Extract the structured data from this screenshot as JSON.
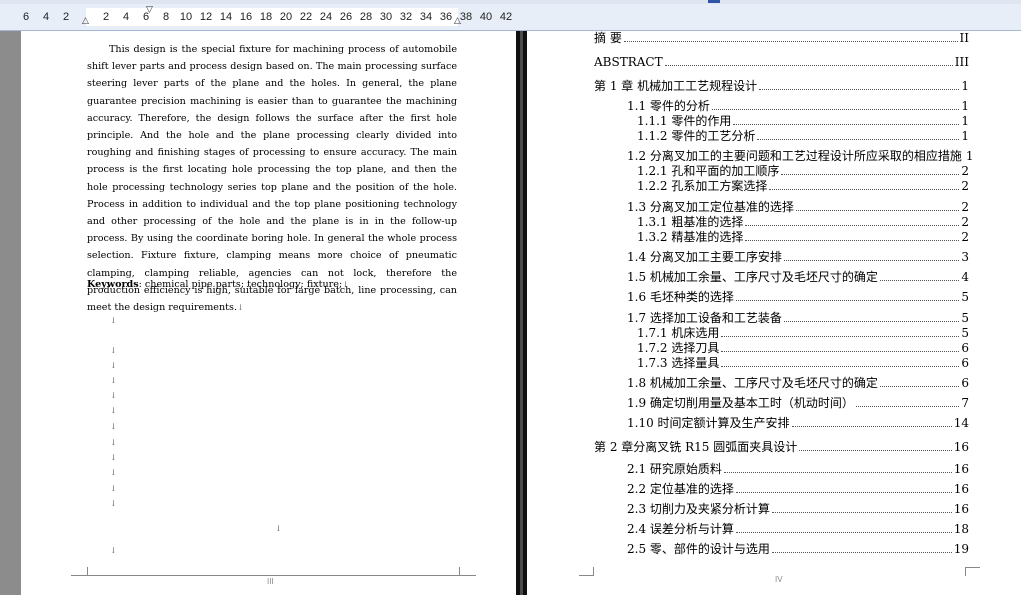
{
  "ruler": {
    "ticks": [
      "6",
      "4",
      "2",
      "2",
      "4",
      "6",
      "8",
      "10",
      "12",
      "14",
      "16",
      "18",
      "20",
      "22",
      "24",
      "26",
      "28",
      "30",
      "32",
      "34",
      "36",
      "38",
      "40",
      "42"
    ]
  },
  "left_page": {
    "abstract_text": "This design is the special fixture for machining process of automobile shift lever parts and process design based on. The main processing surface steering lever parts of the plane and the holes. In general, the plane guarantee precision machining is easier than to guarantee the machining accuracy. Therefore, the design follows the surface after the first hole principle. And the hole and the plane processing clearly divided into roughing and finishing stages of processing to ensure accuracy. The main process is the first locating hole processing the top plane, and then the hole processing technology series top plane and the position of the hole. Process in addition to individual and the top plane positioning technology and other processing of the hole and the plane is in in the follow-up process. By using the coordinate boring hole. In general the whole process selection. Fixture fixture, clamping means more choice of pneumatic clamping, clamping reliable, agencies can not lock, therefore the production efficiency is high, suitable for large batch, line processing, can meet the design requirements.",
    "abstract_end_mark": "↓",
    "keywords_label": "Keywords",
    "keywords_text": ": chemical pipe parts; technology; fixture;",
    "keywords_end_mark": "↓",
    "paragraph_mark": "↓",
    "page_number": "III"
  },
  "right_page": {
    "page_number": "IV",
    "toc": [
      {
        "title": "摘  要",
        "page": "II",
        "level": 0
      },
      {
        "title": "ABSTRACT",
        "page": "III",
        "level": 0
      },
      {
        "title": "第 1 章  机械加工工艺规程设计",
        "page": "1",
        "level": 0
      },
      {
        "title": "1.1  零件的分析",
        "page": "1",
        "level": 1
      },
      {
        "title": "1.1.1  零件的作用",
        "page": "1",
        "level": 2
      },
      {
        "title": "1.1.2  零件的工艺分析",
        "page": "1",
        "level": 2
      },
      {
        "title": "1.2  分离叉加工的主要问题和工艺过程设计所应采取的相应措施",
        "page": "1",
        "level": 1
      },
      {
        "title": "1.2.1  孔和平面的加工顺序",
        "page": "2",
        "level": 2
      },
      {
        "title": "1.2.2  孔系加工方案选择",
        "page": "2",
        "level": 2
      },
      {
        "title": "1.3  分离叉加工定位基准的选择",
        "page": "2",
        "level": 1
      },
      {
        "title": "1.3.1  粗基准的选择",
        "page": "2",
        "level": 2
      },
      {
        "title": "1.3.2  精基准的选择",
        "page": "2",
        "level": 2
      },
      {
        "title": "1.4  分离叉加工主要工序安排",
        "page": "3",
        "level": 1
      },
      {
        "title": "1.5  机械加工余量、工序尺寸及毛坯尺寸的确定",
        "page": "4",
        "level": 1
      },
      {
        "title": "1.6  毛坯种类的选择",
        "page": "5",
        "level": 1
      },
      {
        "title": "1.7  选择加工设备和工艺装备",
        "page": "5",
        "level": 1
      },
      {
        "title": "1.7.1  机床选用",
        "page": "5",
        "level": 2
      },
      {
        "title": "1.7.2  选择刀具",
        "page": "6",
        "level": 2
      },
      {
        "title": "1.7.3  选择量具",
        "page": "6",
        "level": 2
      },
      {
        "title": "1.8  机械加工余量、工序尺寸及毛坯尺寸的确定",
        "page": "6",
        "level": 1
      },
      {
        "title": "1.9 确定切削用量及基本工时（机动时间）",
        "page": "7",
        "level": 1
      },
      {
        "title": "1.10  时间定额计算及生产安排",
        "page": "14",
        "level": 1
      },
      {
        "title": "第 2 章分离叉铣 R15 圆弧面夹具设计",
        "page": "16",
        "level": 0
      },
      {
        "title": "2.1 研究原始质料",
        "page": "16",
        "level": 1
      },
      {
        "title": "2.2 定位基准的选择",
        "page": "16",
        "level": 1
      },
      {
        "title": "2.3  切削力及夹紧分析计算",
        "page": "16",
        "level": 1
      },
      {
        "title": "2.4  误差分析与计算",
        "page": "18",
        "level": 1
      },
      {
        "title": "2.5  零、部件的设计与选用",
        "page": "19",
        "level": 1
      }
    ]
  }
}
